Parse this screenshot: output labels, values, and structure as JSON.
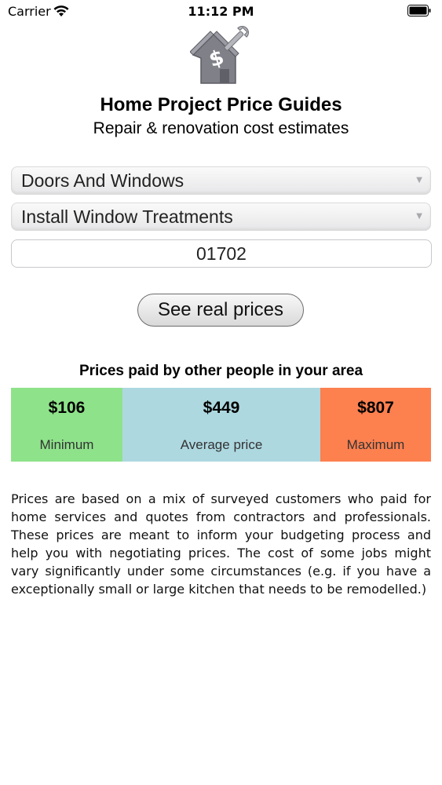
{
  "status_bar": {
    "carrier": "Carrier",
    "time": "11:12 PM"
  },
  "icons": {
    "wifi": "wifi-icon",
    "battery": "battery-icon",
    "logo": "house-dollar-wrench-icon",
    "chevron": "chevron-down-icon"
  },
  "header": {
    "title": "Home Project Price Guides",
    "subtitle": "Repair & renovation cost estimates"
  },
  "form": {
    "category": "Doors And Windows",
    "project": "Install Window Treatments",
    "zip": "01702",
    "submit_label": "See real prices"
  },
  "prices": {
    "heading": "Prices paid by other people in your area",
    "minimum": {
      "value": "$106",
      "label": "Minimum",
      "color": "#8ee28a"
    },
    "average": {
      "value": "$449",
      "label": "Average price",
      "color": "#add8e0"
    },
    "maximum": {
      "value": "$807",
      "label": "Maximum",
      "color": "#fd804f"
    }
  },
  "disclaimer": "Prices are based on a mix of surveyed customers who paid for home services and quotes from contractors and professionals. These prices are meant to inform your budgeting process and help you with negotiating prices. The cost of some jobs might vary significantly under some circumstances (e.g. if you have a exceptionally small or large kitchen that needs to be remodelled.)"
}
